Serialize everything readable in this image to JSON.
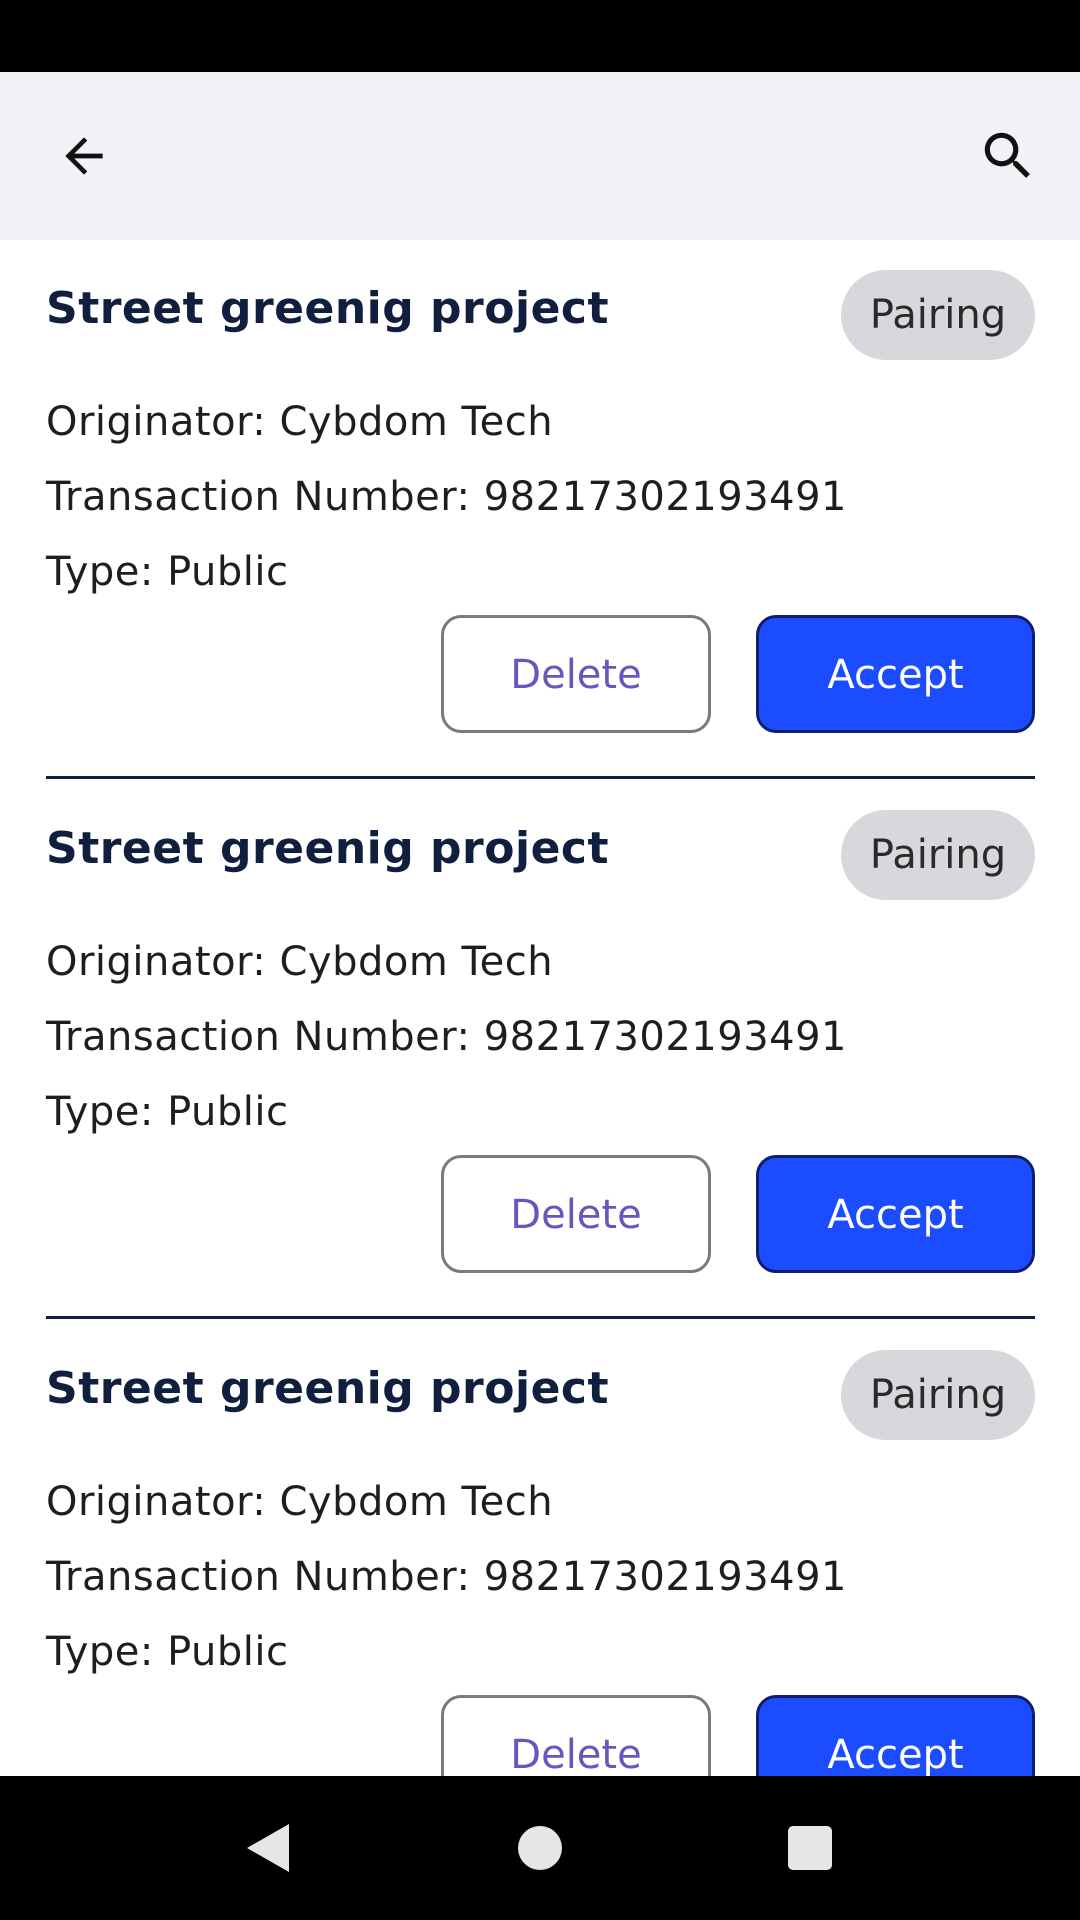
{
  "app_bar": {
    "back_icon": "arrow-back-icon",
    "search_icon": "search-icon",
    "background": "#f2f1f6"
  },
  "colors": {
    "accent": "#1c4cff",
    "title": "#0f1f3d",
    "badge_bg": "#d8d8dc",
    "delete_text": "#6a55c0"
  },
  "cards": [
    {
      "title": "Street greenig project",
      "status": "Pairing",
      "originator": "Originator: Cybdom Tech",
      "transaction": "Transaction Number: 98217302193491",
      "type": "Type: Public",
      "delete_label": "Delete",
      "accept_label": "Accept"
    },
    {
      "title": "Street greenig project",
      "status": "Pairing",
      "originator": "Originator: Cybdom Tech",
      "transaction": "Transaction Number: 98217302193491",
      "type": "Type: Public",
      "delete_label": "Delete",
      "accept_label": "Accept"
    },
    {
      "title": "Street greenig project",
      "status": "Pairing",
      "originator": "Originator: Cybdom Tech",
      "transaction": "Transaction Number: 98217302193491",
      "type": "Type: Public",
      "delete_label": "Delete",
      "accept_label": "Accept"
    }
  ],
  "nav_bar": {
    "back_icon": "nav-back-triangle-icon",
    "home_icon": "nav-home-circle-icon",
    "recents_icon": "nav-recents-square-icon"
  }
}
